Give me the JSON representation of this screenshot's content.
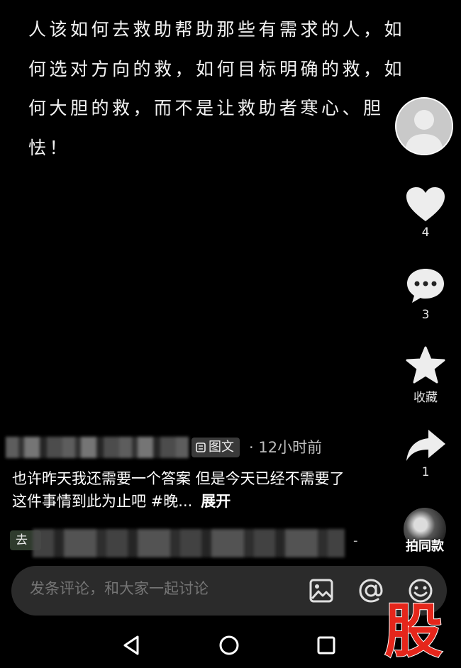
{
  "post": {
    "text": "人该如何去救助帮助那些有需求的人，如何选对方向的救，如何目标明确的救，如何大胆的救，而不是让救助者寒心、胆怯！"
  },
  "sidebar": {
    "like_count": "4",
    "comment_count": "3",
    "favorite_label": "收藏",
    "share_count": "1",
    "shop_label": "拍同款"
  },
  "meta": {
    "type_tag": "图文",
    "time": "· 12小时前"
  },
  "caption": {
    "text": "也许昨天我还需要一个答案 但是今天已经不需要了 这件事情到此为止吧 #晚...",
    "more_label": "展开"
  },
  "link": {
    "prefix": "去",
    "suffix": "-"
  },
  "comment_bar": {
    "placeholder": "发条评论，和大家一起讨论"
  },
  "watermark": {
    "char": "股"
  },
  "colors": {
    "background": "#000000",
    "watermark_red": "#e5261b",
    "bar_bg": "#2b2b2b"
  }
}
